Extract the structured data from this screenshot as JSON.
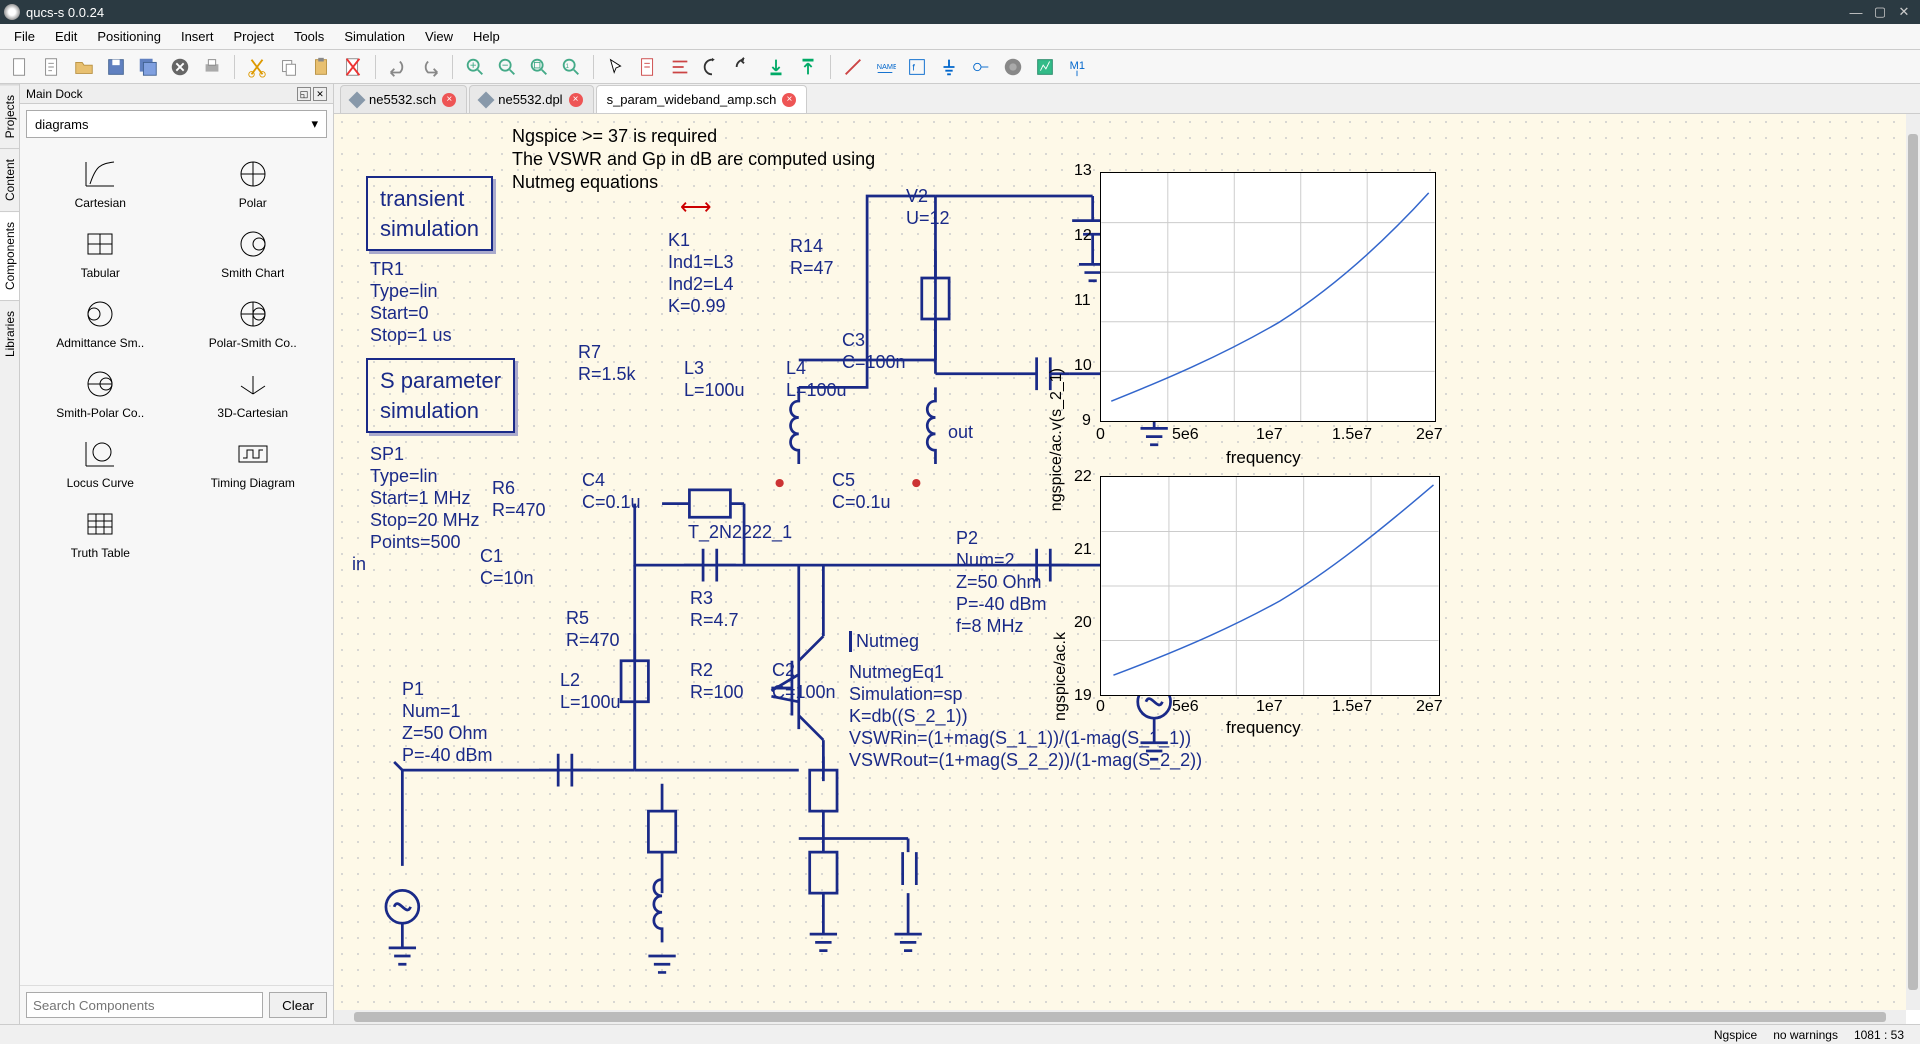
{
  "app": {
    "title": "qucs-s 0.0.24"
  },
  "menu": {
    "file": "File",
    "edit": "Edit",
    "pos": "Positioning",
    "insert": "Insert",
    "project": "Project",
    "tools": "Tools",
    "sim": "Simulation",
    "view": "View",
    "help": "Help"
  },
  "dock": {
    "title": "Main Dock",
    "select": "diagrams",
    "search_placeholder": "Search Components",
    "clear": "Clear",
    "items": [
      "Cartesian",
      "Polar",
      "Tabular",
      "Smith Chart",
      "Admittance Sm..",
      "Polar-Smith Co..",
      "Smith-Polar Co..",
      "3D-Cartesian",
      "Locus Curve",
      "Timing Diagram",
      "Truth Table"
    ],
    "sidetabs": [
      "Projects",
      "Content",
      "Components",
      "Libraries"
    ]
  },
  "tabs": [
    {
      "name": "ne5532.sch",
      "close": true
    },
    {
      "name": "ne5532.dpl",
      "close": true
    },
    {
      "name": "s_param_wideband_amp.sch",
      "close": true,
      "active": true
    }
  ],
  "notes": {
    "l1": "Ngspice >= 37 is required",
    "l2": "The VSWR and Gp in dB are computed using",
    "l3": "Nutmeg equations"
  },
  "sim_boxes": {
    "tr": "transient\nsimulation",
    "sp": "S parameter\nsimulation"
  },
  "sch": {
    "TR1": {
      "name": "TR1",
      "p": [
        "Type=lin",
        "Start=0",
        "Stop=1 us"
      ]
    },
    "SP1": {
      "name": "SP1",
      "p": [
        "Type=lin",
        "Start=1 MHz",
        "Stop=20 MHz",
        "Points=500"
      ]
    },
    "P1": {
      "name": "P1",
      "p": [
        "Num=1",
        "Z=50 Ohm",
        "P=-40 dBm"
      ]
    },
    "P2": {
      "name": "P2",
      "p": [
        "Num=2",
        "Z=50 Ohm",
        "P=-40 dBm",
        "f=8 MHz"
      ]
    },
    "V2": {
      "name": "V2",
      "p": [
        "U=12"
      ]
    },
    "R14": {
      "name": "R14",
      "p": [
        "R=47"
      ]
    },
    "R7": {
      "name": "R7",
      "p": [
        "R=1.5k"
      ]
    },
    "R6": {
      "name": "R6",
      "p": [
        "R=470"
      ]
    },
    "R5": {
      "name": "R5",
      "p": [
        "R=470"
      ]
    },
    "R3": {
      "name": "R3",
      "p": [
        "R=4.7"
      ]
    },
    "R2": {
      "name": "R2",
      "p": [
        "R=100"
      ]
    },
    "C1": {
      "name": "C1",
      "p": [
        "C=10n"
      ]
    },
    "C2": {
      "name": "C2",
      "p": [
        "C=100n"
      ]
    },
    "C3": {
      "name": "C3",
      "p": [
        "C=100n"
      ]
    },
    "C4": {
      "name": "C4",
      "p": [
        "C=0.1u"
      ]
    },
    "C5": {
      "name": "C5",
      "p": [
        "C=0.1u"
      ]
    },
    "L2": {
      "name": "L2",
      "p": [
        "L=100u"
      ]
    },
    "L3": {
      "name": "L3",
      "p": [
        "L=100u"
      ]
    },
    "L4": {
      "name": "L4",
      "p": [
        "L=100u"
      ]
    },
    "K1": {
      "name": "K1",
      "p": [
        "Ind1=L3",
        "Ind2=L4",
        "K=0.99"
      ]
    },
    "Q": {
      "name": "T_2N2222_1"
    },
    "in": "in",
    "out": "out",
    "nutmeg": {
      "title": "Nutmeg",
      "name": "NutmegEq1",
      "p": [
        "Simulation=sp",
        "K=db((S_2_1))",
        "VSWRin=(1+mag(S_1_1))/(1-mag(S_1_1))",
        "VSWRout=(1+mag(S_2_2))/(1-mag(S_2_2))"
      ]
    }
  },
  "plots": {
    "top": {
      "xlabel": "frequency",
      "ylabel": "ngspice/ac.v(s_2_1)",
      "xticks": [
        "0",
        "5e6",
        "1e7",
        "1.5e7",
        "2e7"
      ],
      "yticks": [
        "9",
        "10",
        "11",
        "12",
        "13"
      ]
    },
    "bot": {
      "xlabel": "frequency",
      "ylabel": "ngspice/ac.k",
      "xticks": [
        "0",
        "5e6",
        "1e7",
        "1.5e7",
        "2e7"
      ],
      "yticks": [
        "19",
        "20",
        "21",
        "22"
      ]
    }
  },
  "status": {
    "sim": "Ngspice",
    "warn": "no warnings",
    "coord": "1081 : 53"
  },
  "chart_data": [
    {
      "type": "line",
      "title": "",
      "xlabel": "frequency",
      "ylabel": "ngspice/ac.v(s_2_1)",
      "xlim": [
        0,
        20000000.0
      ],
      "ylim": [
        9,
        13
      ],
      "x": [
        1000000.0,
        2500000.0,
        5000000.0,
        7500000.0,
        10000000.0,
        12500000.0,
        15000000.0,
        17500000.0,
        20000000.0
      ],
      "values": [
        9.4,
        9.7,
        10.2,
        10.6,
        11.0,
        11.5,
        11.9,
        12.4,
        12.9
      ]
    },
    {
      "type": "line",
      "title": "",
      "xlabel": "frequency",
      "ylabel": "ngspice/ac.k",
      "xlim": [
        0,
        20000000.0
      ],
      "ylim": [
        19,
        22
      ],
      "x": [
        1000000.0,
        2500000.0,
        5000000.0,
        7500000.0,
        10000000.0,
        12500000.0,
        15000000.0,
        17500000.0,
        20000000.0
      ],
      "values": [
        19.35,
        19.6,
        20.0,
        20.35,
        20.7,
        21.05,
        21.35,
        21.7,
        22.05
      ]
    }
  ]
}
